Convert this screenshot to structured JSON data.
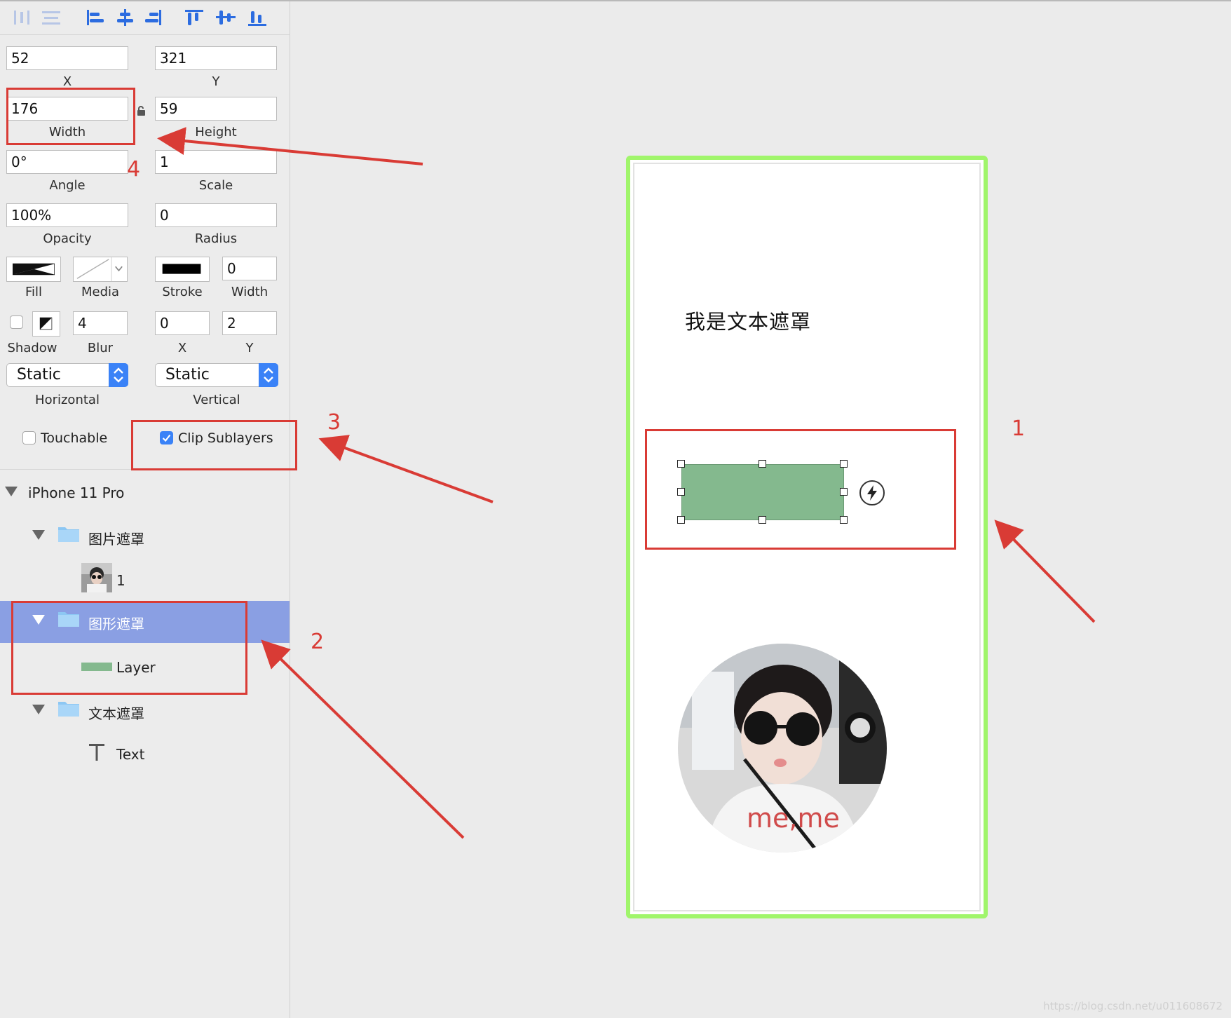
{
  "inspector": {
    "x": {
      "value": "52",
      "label": "X"
    },
    "y": {
      "value": "321",
      "label": "Y"
    },
    "width": {
      "value": "176",
      "label": "Width"
    },
    "height": {
      "value": "59",
      "label": "Height"
    },
    "angle": {
      "value": "0°",
      "label": "Angle"
    },
    "scale": {
      "value": "1",
      "label": "Scale"
    },
    "opacity": {
      "value": "100%",
      "label": "Opacity"
    },
    "radius": {
      "value": "0",
      "label": "Radius"
    },
    "fill_label": "Fill",
    "media_label": "Media",
    "stroke_label": "Stroke",
    "stroke_width": {
      "value": "0",
      "label": "Width"
    },
    "shadow_label": "Shadow",
    "blur": {
      "value": "4",
      "label": "Blur"
    },
    "shadow_x": {
      "value": "0",
      "label": "X"
    },
    "shadow_y": {
      "value": "2",
      "label": "Y"
    },
    "horizontal": {
      "value": "Static",
      "label": "Horizontal"
    },
    "vertical": {
      "value": "Static",
      "label": "Vertical"
    },
    "touchable": {
      "label": "Touchable",
      "checked": false
    },
    "clip_sublayers": {
      "label": "Clip Sublayers",
      "checked": true
    }
  },
  "layers": {
    "root": "iPhone 11 Pro",
    "items": [
      {
        "label": "图片遮罩",
        "type": "folder"
      },
      {
        "label": "1",
        "type": "image"
      },
      {
        "label": "图形遮罩",
        "type": "folder",
        "selected": true
      },
      {
        "label": "Layer",
        "type": "shape"
      },
      {
        "label": "文本遮罩",
        "type": "folder"
      },
      {
        "label": "Text",
        "type": "text"
      }
    ]
  },
  "canvas": {
    "text_mask": "我是文本遮罩",
    "shape_color": "#84b98e",
    "device_border_color": "#a0f56b"
  },
  "annotations": {
    "color": "#d93b35",
    "numbers": [
      "1",
      "2",
      "3",
      "4"
    ]
  },
  "photo_text": "me,me",
  "watermark": "https://blog.csdn.net/u011608672"
}
